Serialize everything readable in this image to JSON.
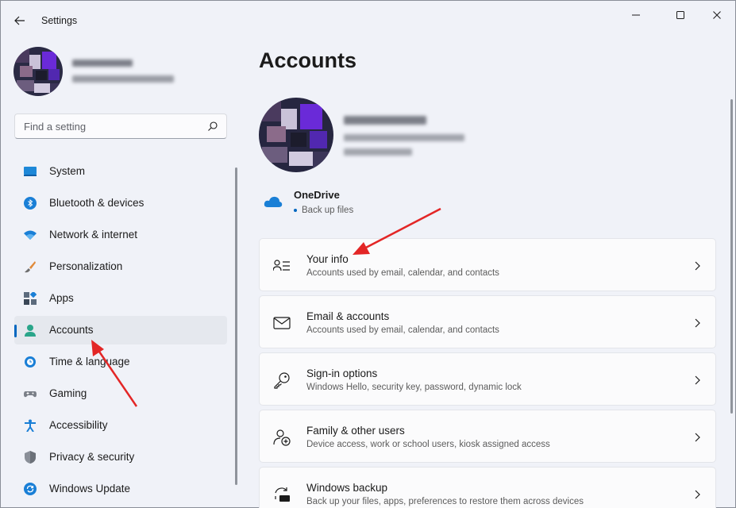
{
  "window": {
    "title": "Settings"
  },
  "search": {
    "placeholder": "Find a setting"
  },
  "sidebar": {
    "items": [
      {
        "label": "System",
        "icon": "system-icon"
      },
      {
        "label": "Bluetooth & devices",
        "icon": "bluetooth-icon"
      },
      {
        "label": "Network & internet",
        "icon": "wifi-icon"
      },
      {
        "label": "Personalization",
        "icon": "brush-icon"
      },
      {
        "label": "Apps",
        "icon": "apps-icon"
      },
      {
        "label": "Accounts",
        "icon": "accounts-icon",
        "selected": true
      },
      {
        "label": "Time & language",
        "icon": "clock-globe-icon"
      },
      {
        "label": "Gaming",
        "icon": "gamepad-icon"
      },
      {
        "label": "Accessibility",
        "icon": "accessibility-icon"
      },
      {
        "label": "Privacy & security",
        "icon": "shield-icon"
      },
      {
        "label": "Windows Update",
        "icon": "sync-icon"
      }
    ]
  },
  "main": {
    "title": "Accounts",
    "onedrive": {
      "title": "OneDrive",
      "status": "Back up files"
    },
    "cards": [
      {
        "title": "Your info",
        "subtitle": "Accounts used by email, calendar, and contacts",
        "icon": "person-info-icon"
      },
      {
        "title": "Email & accounts",
        "subtitle": "Accounts used by email, calendar, and contacts",
        "icon": "mail-icon"
      },
      {
        "title": "Sign-in options",
        "subtitle": "Windows Hello, security key, password, dynamic lock",
        "icon": "key-icon"
      },
      {
        "title": "Family & other users",
        "subtitle": "Device access, work or school users, kiosk assigned access",
        "icon": "add-person-icon"
      },
      {
        "title": "Windows backup",
        "subtitle": "Back up your files, apps, preferences to restore them across devices",
        "icon": "backup-icon"
      }
    ]
  },
  "colors": {
    "accent": "#0067c0",
    "annotation_arrow": "#e32626",
    "background": "#f0f2f8"
  }
}
